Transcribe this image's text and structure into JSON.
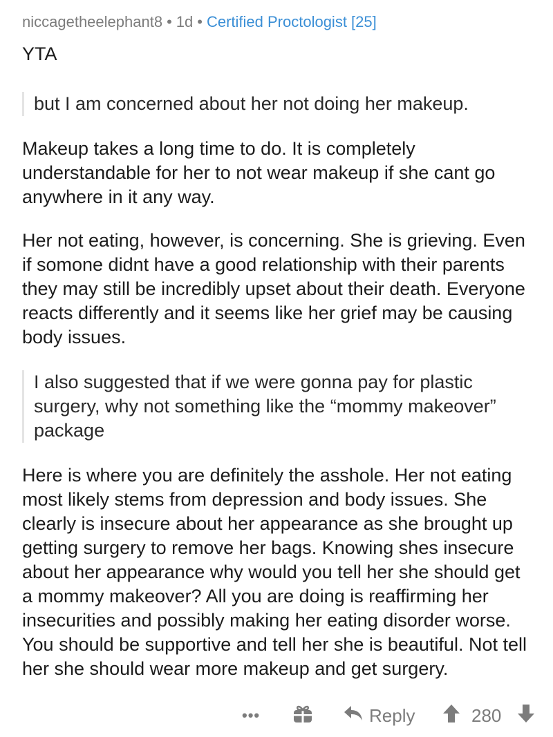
{
  "comment": {
    "username": "niccagetheelephant8",
    "separator": "•",
    "age": "1d",
    "flair": "Certified Proctologist [25]",
    "paragraphs": {
      "yta": "YTA",
      "quote1": "but I am concerned about her not doing her makeup.",
      "p2": "Makeup takes a long time to do. It is completely understandable for her to not wear makeup if she cant go anywhere in it any way.",
      "p3": "Her not eating, however, is concerning. She is grieving. Even if somone didnt have a good relationship with their parents they may still be incredibly upset about their death. Everyone reacts differently and it seems like her grief may be causing body issues.",
      "quote2": "I also suggested that if we were gonna pay for plastic surgery, why not something like the “mommy makeover” package",
      "p4": "Here is where you are definitely the asshole. Her not eating most likely stems from depression and body issues. She clearly is insecure about her appearance as she brought up getting surgery to remove her bags. Knowing shes insecure about her appearance why would you tell her she should get a mommy makeover? All you are doing is reaffirming her insecurities and possibly making her eating disorder worse. You should be supportive and tell her she is beautiful. Not tell her she should wear more makeup and get surgery."
    }
  },
  "actions": {
    "more_label": "•••",
    "reply_label": "Reply",
    "score": "280"
  },
  "colors": {
    "meta": "#7c7c7c",
    "flair": "#3b8fd6",
    "quote_bar": "#e4e4e4"
  },
  "icons": [
    "gift-icon",
    "reply-arrow-icon",
    "upvote-arrow-icon",
    "downvote-arrow-icon"
  ]
}
